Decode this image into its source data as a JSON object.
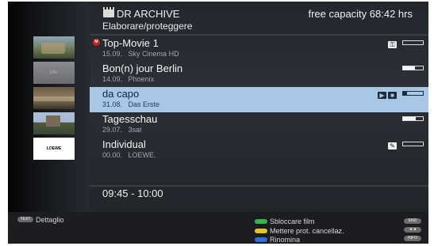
{
  "header": {
    "title": "DR ARCHIVE",
    "subtitle": "Elaborare/proteggere",
    "capacity": "free capacity 68:42 hrs"
  },
  "thumbnails": [
    {
      "label": ""
    },
    {
      "label": "DR+"
    },
    {
      "label": ""
    },
    {
      "label": ""
    },
    {
      "label": "LOEWE"
    }
  ],
  "recordings": [
    {
      "title": "Top-Movie 1",
      "date": "15.09.",
      "channel": "Sky Cinema HD",
      "rec_badge": "M",
      "icons": [
        "key-icon"
      ],
      "progress": 0.0,
      "selected": false
    },
    {
      "title": "Bon(n) jour Berlin",
      "date": "14.09.",
      "channel": "Phoenix",
      "icons": [],
      "progress": 0.6,
      "selected": false
    },
    {
      "title": "da capo",
      "date": "31.08.",
      "channel": "Das Erste",
      "icons": [
        "play-resume-icon",
        "lock-icon"
      ],
      "progress": 0.2,
      "selected": true
    },
    {
      "title": "Tagesschau",
      "date": "29.07.",
      "channel": "3sat",
      "icons": [],
      "progress": 0.65,
      "selected": false
    },
    {
      "title": "Individual",
      "date": "00.00.",
      "channel": "LOEWE.",
      "icons": [
        "edit-icon"
      ],
      "progress": 0.0,
      "selected": false
    }
  ],
  "time_range": "09:45 - 10:00",
  "footer": {
    "text_key": "TEXT",
    "detail_label": "Dettaglio",
    "actions": [
      {
        "label": "Sbloccare film",
        "color": "#37b24d"
      },
      {
        "label": "Mettere prot. cancellaz.",
        "color": "#e6c619"
      },
      {
        "label": "Rinomina",
        "color": "#2f6fd6"
      }
    ],
    "keys": [
      "END",
      "◄◄",
      "INFO"
    ]
  },
  "colors": {
    "selected_row": "#a8c6e6",
    "panel": "#2c3036",
    "background": "#0c0c0c"
  }
}
